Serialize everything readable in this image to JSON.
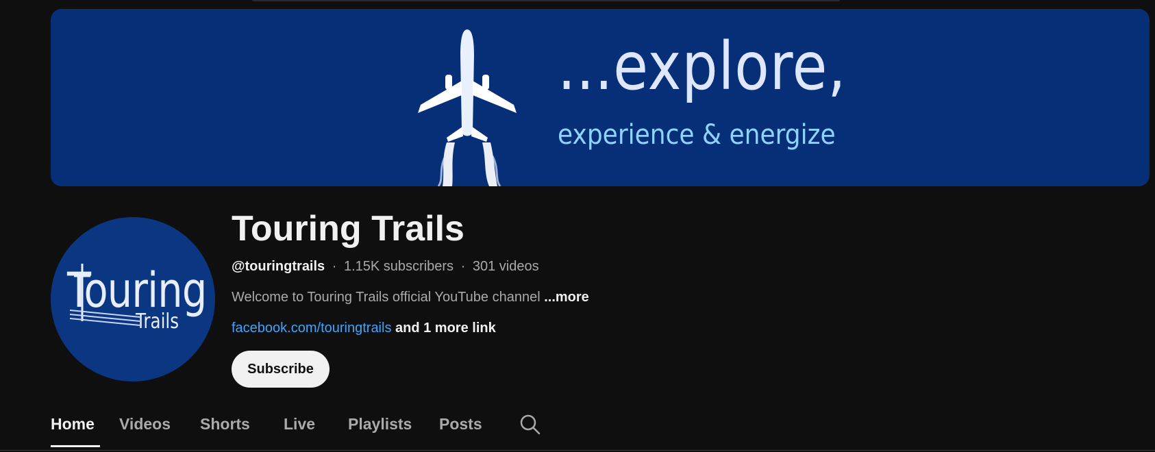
{
  "banner": {
    "tagline": "...explore,",
    "subtagline": "experience & energize",
    "background_color": "#062f78"
  },
  "avatar": {
    "word": "Touring",
    "sub": "Trails",
    "background_color": "#0a3682"
  },
  "channel": {
    "name": "Touring Trails",
    "handle": "@touringtrails",
    "subscribers": "1.15K subscribers",
    "videos": "301 videos",
    "separator": "·",
    "description": "Welcome to Touring Trails official YouTube channel",
    "description_more": "...more",
    "link_text": "facebook.com/touringtrails",
    "more_links": "and 1 more link",
    "subscribe_label": "Subscribe"
  },
  "tabs": [
    {
      "label": "Home",
      "active": true
    },
    {
      "label": "Videos",
      "active": false
    },
    {
      "label": "Shorts",
      "active": false
    },
    {
      "label": "Live",
      "active": false
    },
    {
      "label": "Playlists",
      "active": false
    },
    {
      "label": "Posts",
      "active": false
    }
  ],
  "icons": {
    "search": "search-icon"
  },
  "colors": {
    "page_background": "#0f0f0f",
    "link": "#3ea6ff",
    "text_primary": "#f1f1f1",
    "text_secondary": "#aaaaaa"
  }
}
